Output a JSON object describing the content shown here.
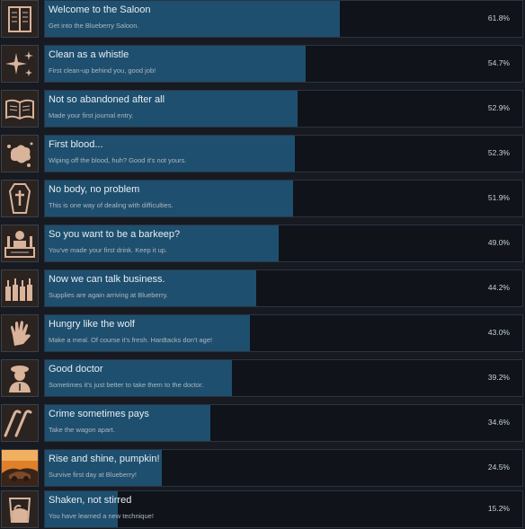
{
  "achievements": [
    {
      "title": "Welcome to the Saloon",
      "description": "Get into the Blueberry Saloon.",
      "percent_label": "61.8%",
      "percent": 61.8,
      "icon": "book-icon"
    },
    {
      "title": "Clean as a whistle",
      "description": "First clean-up behind you, good job!",
      "percent_label": "54.7%",
      "percent": 54.7,
      "icon": "sparkles-icon"
    },
    {
      "title": "Not so abandoned after all",
      "description": "Made your first journal entry.",
      "percent_label": "52.9%",
      "percent": 52.9,
      "icon": "open-book-icon"
    },
    {
      "title": "First blood...",
      "description": "Wiping off the blood, huh? Good it's not yours.",
      "percent_label": "52.3%",
      "percent": 52.3,
      "icon": "blood-splatter-icon"
    },
    {
      "title": "No body, no problem",
      "description": "This is one way of dealing with difficulties.",
      "percent_label": "51.9%",
      "percent": 51.9,
      "icon": "coffin-icon"
    },
    {
      "title": "So you want to be a barkeep?",
      "description": "You've made your first drink. Keep it up.",
      "percent_label": "49.0%",
      "percent": 49.0,
      "icon": "barkeep-icon"
    },
    {
      "title": "Now we can talk business.",
      "description": "Supplies are again arriving at Blueberry.",
      "percent_label": "44.2%",
      "percent": 44.2,
      "icon": "bottles-icon"
    },
    {
      "title": "Hungry like the wolf",
      "description": "Make a meal. Of course it's fresh. Hardtacks don't age!",
      "percent_label": "43.0%",
      "percent": 43.0,
      "icon": "hand-icon"
    },
    {
      "title": "Good doctor",
      "description": "Sometimes it's just better to take them to the doctor.",
      "percent_label": "39.2%",
      "percent": 39.2,
      "icon": "doctor-icon"
    },
    {
      "title": "Crime sometimes pays",
      "description": "Take the wagon apart.",
      "percent_label": "34.6%",
      "percent": 34.6,
      "icon": "crowbar-icon"
    },
    {
      "title": "Rise and shine, pumpkin!",
      "description": "Survive first day at Blueberry!",
      "percent_label": "24.5%",
      "percent": 24.5,
      "icon": "sunrise-icon"
    },
    {
      "title": "Shaken, not stirred",
      "description": "You have learned a new technique!",
      "percent_label": "15.2%",
      "percent": 15.2,
      "icon": "glass-icon"
    }
  ],
  "colors": {
    "background": "#171a21",
    "bar_fill": "#1e4f6e",
    "bar_bg": "#10131a",
    "icon_ink": "#d9b39a",
    "sunrise_sky": "#e0802a"
  }
}
